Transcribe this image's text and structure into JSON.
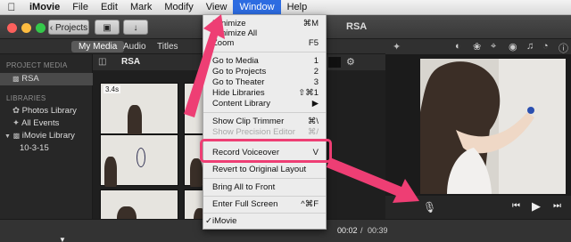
{
  "menubar": {
    "app": "iMovie",
    "items": [
      "File",
      "Edit",
      "Mark",
      "Modify",
      "View",
      "Window",
      "Help"
    ]
  },
  "toolbar": {
    "projects_label": "Projects",
    "window_title": "RSA"
  },
  "tabs": [
    "My Media",
    "Audio",
    "Titles"
  ],
  "sidebar": {
    "project_media_heading": "PROJECT MEDIA",
    "project": "RSA",
    "libraries_heading": "LIBRARIES",
    "items": [
      "Photos Library",
      "All Events",
      "iMovie Library",
      "10-3-15"
    ]
  },
  "browser": {
    "title": "RSA",
    "clip_duration": "3.4s"
  },
  "window_menu": {
    "items": [
      {
        "label": "Minimize",
        "shortcut": "⌘M"
      },
      {
        "label": "Minimize All",
        "shortcut": ""
      },
      {
        "label": "Zoom",
        "shortcut": "F5"
      },
      {
        "label": "Go to Media",
        "shortcut": "1"
      },
      {
        "label": "Go to Projects",
        "shortcut": "2"
      },
      {
        "label": "Go to Theater",
        "shortcut": "3"
      },
      {
        "label": "Hide Libraries",
        "shortcut": "⇧⌘1"
      },
      {
        "label": "Content Library",
        "shortcut": "▶"
      },
      {
        "label": "Show Clip Trimmer",
        "shortcut": "⌘\\"
      },
      {
        "label": "Show Precision Editor",
        "shortcut": "⌘/"
      },
      {
        "label": "Record Voiceover",
        "shortcut": "V"
      },
      {
        "label": "Revert to Original Layout",
        "shortcut": ""
      },
      {
        "label": "Bring All to Front",
        "shortcut": ""
      },
      {
        "label": "Enter Full Screen",
        "shortcut": "^⌘F"
      },
      {
        "label": "iMovie",
        "shortcut": ""
      }
    ]
  },
  "timeline": {
    "current": "00:02",
    "separator": "/",
    "total": "00:39"
  },
  "colors": {
    "accent": "#2d6ce1",
    "annotation": "#ee3e74"
  }
}
